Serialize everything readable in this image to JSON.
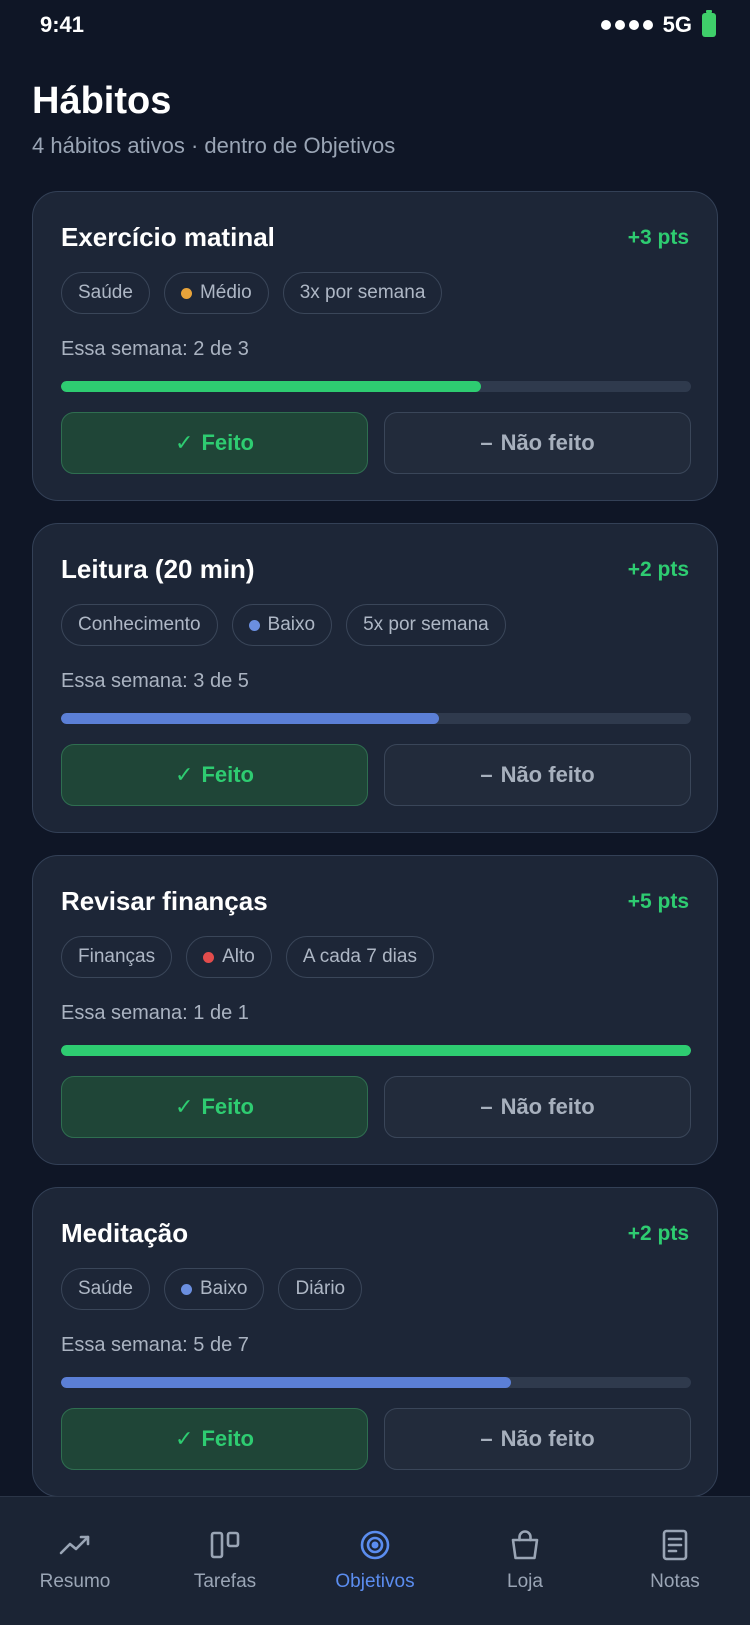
{
  "status_bar": {
    "time": "9:41",
    "network": "5G"
  },
  "header": {
    "title": "Hábitos",
    "subtitle": "4 hábitos ativos · dentro de Objetivos"
  },
  "buttons": {
    "done_icon": "✓",
    "done_label": "Feito",
    "not_done_icon": "–",
    "not_done_label": "Não feito"
  },
  "habits": [
    {
      "title": "Exercício matinal",
      "points": "+3 pts",
      "category": "Saúde",
      "priority": "Médio",
      "priority_color": "#e8a33a",
      "frequency": "3x por semana",
      "week_text": "Essa semana: 2 de 3",
      "progress": 0.667,
      "progress_color": "#2ecc71"
    },
    {
      "title": "Leitura (20 min)",
      "points": "+2 pts",
      "category": "Conhecimento",
      "priority": "Baixo",
      "priority_color": "#6b8fe0",
      "frequency": "5x por semana",
      "week_text": "Essa semana: 3 de 5",
      "progress": 0.6,
      "progress_color": "#5b7fd6"
    },
    {
      "title": "Revisar finanças",
      "points": "+5 pts",
      "category": "Finanças",
      "priority": "Alto",
      "priority_color": "#e24c4c",
      "frequency": "A cada 7 dias",
      "week_text": "Essa semana: 1 de 1",
      "progress": 1.0,
      "progress_color": "#2ecc71"
    },
    {
      "title": "Meditação",
      "points": "+2 pts",
      "category": "Saúde",
      "priority": "Baixo",
      "priority_color": "#6b8fe0",
      "frequency": "Diário",
      "week_text": "Essa semana: 5 de 7",
      "progress": 0.714,
      "progress_color": "#5b7fd6"
    }
  ],
  "tab_bar": {
    "active": "objetivos",
    "tabs": [
      {
        "id": "resumo",
        "label": "Resumo",
        "icon": "trend-up-icon"
      },
      {
        "id": "tarefas",
        "label": "Tarefas",
        "icon": "board-icon"
      },
      {
        "id": "objetivos",
        "label": "Objetivos",
        "icon": "target-icon"
      },
      {
        "id": "loja",
        "label": "Loja",
        "icon": "bag-icon"
      },
      {
        "id": "notas",
        "label": "Notas",
        "icon": "note-icon"
      }
    ]
  },
  "colors": {
    "accent": "#5b8def",
    "success": "#2ecc71",
    "background": "#0f1626",
    "card": "#1d2637"
  }
}
